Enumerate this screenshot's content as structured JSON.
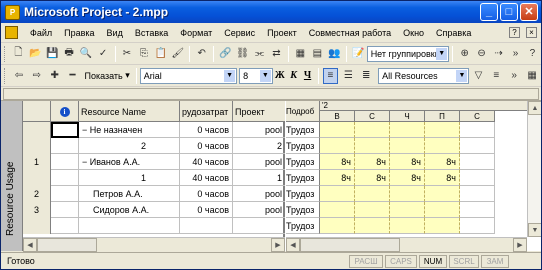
{
  "window": {
    "title": "Microsoft Project - 2.mpp"
  },
  "menu": [
    "Файл",
    "Правка",
    "Вид",
    "Вставка",
    "Формат",
    "Сервис",
    "Проект",
    "Совместная работа",
    "Окно",
    "Справка"
  ],
  "toolbar1": {
    "grouping": "Нет группировки"
  },
  "toolbar2": {
    "show_label": "Показать",
    "font": "Arial",
    "size": "8",
    "bold": "Ж",
    "italic": "К",
    "underline": "Ч",
    "filter": "All Resources"
  },
  "sidebar": {
    "label": "Resource Usage"
  },
  "grid": {
    "columns": [
      "",
      "i",
      "Resource Name",
      "рудозатрат",
      "Проект"
    ],
    "rows": [
      {
        "id": "",
        "name": "− Не назначен",
        "work": "0 часов",
        "project": "pool"
      },
      {
        "id": "",
        "name": "2",
        "work": "0 часов",
        "project": "2"
      },
      {
        "id": "1",
        "name": "− Иванов А.А.",
        "work": "40 часов",
        "project": "pool"
      },
      {
        "id": "",
        "name": "1",
        "work": "40 часов",
        "project": "1"
      },
      {
        "id": "2",
        "name": "Петров А.А.",
        "work": "0 часов",
        "project": "pool"
      },
      {
        "id": "3",
        "name": "Сидоров А.А.",
        "work": "0 часов",
        "project": "pool"
      },
      {
        "id": "",
        "name": "",
        "work": "",
        "project": ""
      },
      {
        "id": "",
        "name": "",
        "work": "",
        "project": ""
      }
    ]
  },
  "usage": {
    "detail_header": "Подроб",
    "week": "'2",
    "days": [
      "В",
      "С",
      "Ч",
      "П",
      "С"
    ],
    "detail_label": "Трудоз",
    "values": [
      [
        "",
        "",
        "",
        "",
        ""
      ],
      [
        "",
        "",
        "",
        "",
        ""
      ],
      [
        "8ч",
        "8ч",
        "8ч",
        "8ч",
        ""
      ],
      [
        "8ч",
        "8ч",
        "8ч",
        "8ч",
        ""
      ],
      [
        "",
        "",
        "",
        "",
        ""
      ],
      [
        "",
        "",
        "",
        "",
        ""
      ],
      [
        "",
        "",
        "",
        "",
        ""
      ],
      [
        "",
        "",
        "",
        "",
        ""
      ]
    ]
  },
  "status": {
    "text": "Готово",
    "indicators": [
      "РАСШ",
      "CAPS",
      "NUM",
      "SCRL",
      "ЗАМ"
    ]
  }
}
